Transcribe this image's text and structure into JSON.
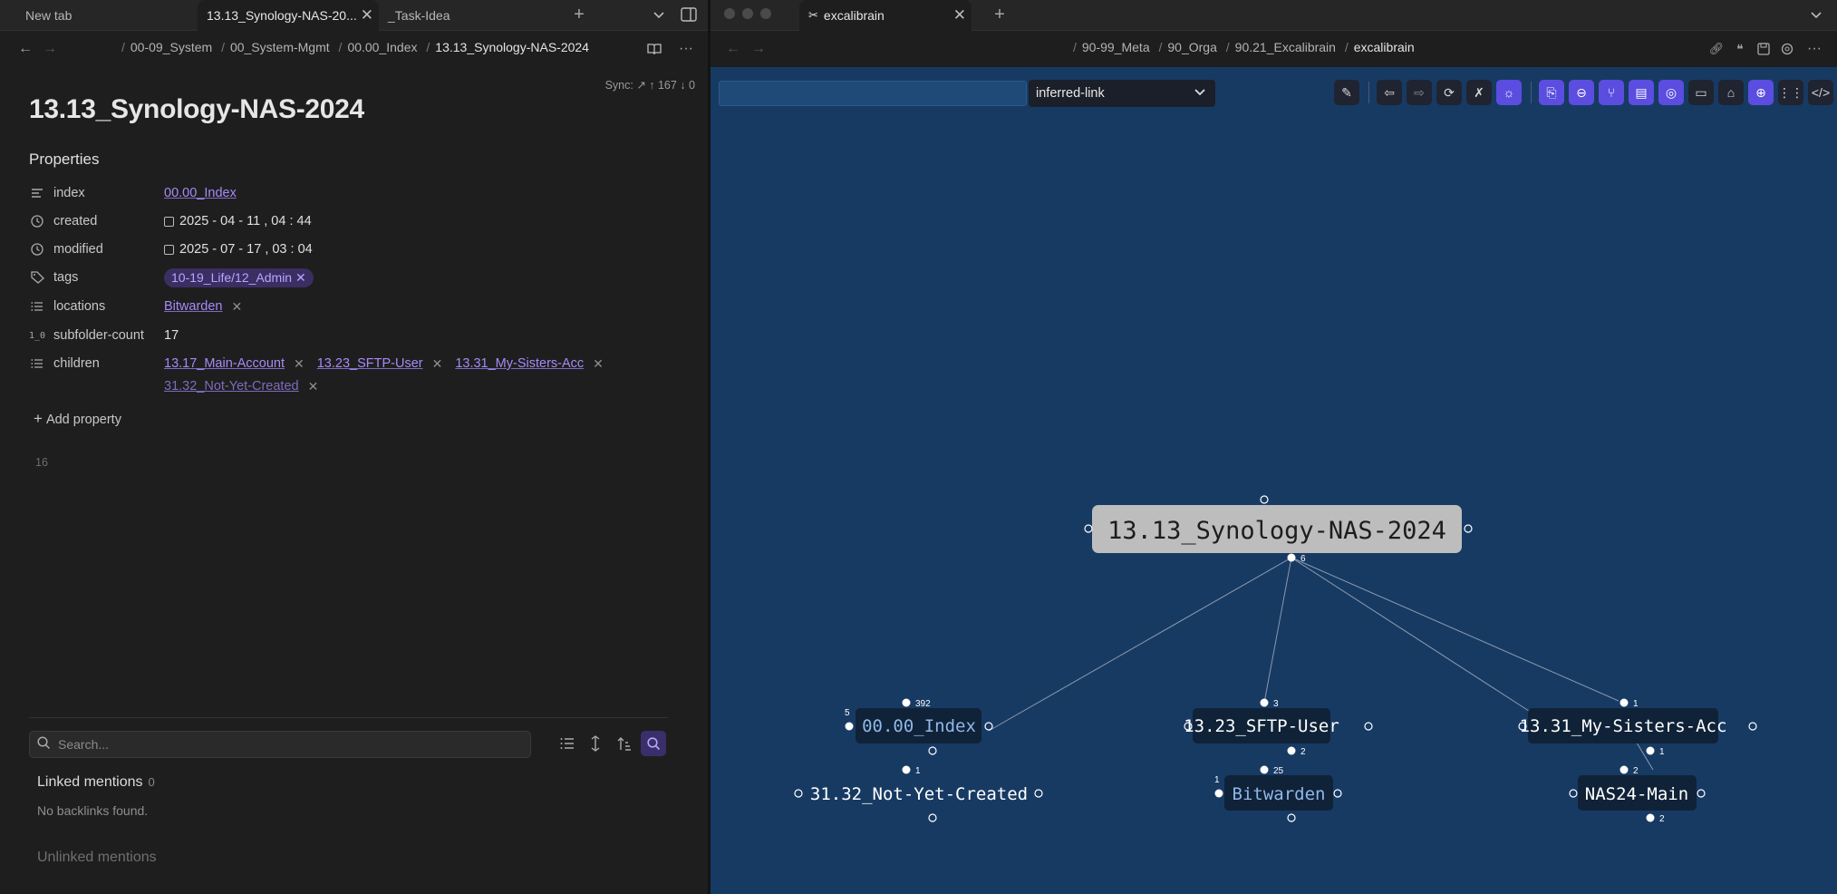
{
  "left": {
    "tabs": [
      {
        "label": "New tab"
      },
      {
        "label": "13.13_Synology-NAS-20..."
      },
      {
        "label": "_Task-Idea"
      }
    ],
    "breadcrumb": [
      {
        "label": "00-09_System"
      },
      {
        "label": "00_System-Mgmt"
      },
      {
        "label": "00.00_Index"
      },
      {
        "label": "13.13_Synology-NAS-2024"
      }
    ],
    "sync_text": "Sync: ↗ ↑ 167 ↓ 0",
    "title": "13.13_Synology-NAS-2024",
    "properties_heading": "Properties",
    "properties": {
      "index": {
        "key": "index",
        "value": "00.00_Index"
      },
      "created": {
        "key": "created",
        "date": "2025 - 04 - 11 ,  04 : 44"
      },
      "modified": {
        "key": "modified",
        "date": "2025 - 07 - 17 ,  03 : 04"
      },
      "tags": {
        "key": "tags",
        "value": "10-19_Life/12_Admin"
      },
      "locations": {
        "key": "locations",
        "value": "Bitwarden"
      },
      "subfolder": {
        "key": "subfolder-count",
        "value": "17"
      },
      "children": {
        "key": "children",
        "items": [
          {
            "label": "13.17_Main-Account"
          },
          {
            "label": "13.23_SFTP-User"
          },
          {
            "label": "13.31_My-Sisters-Acc"
          },
          {
            "label": "31.32_Not-Yet-Created"
          }
        ]
      }
    },
    "add_property": "Add property",
    "line_number": "16",
    "backlinks": {
      "search_placeholder": "Search...",
      "linked_title": "Linked mentions",
      "linked_count": "0",
      "no_backlinks": "No backlinks found.",
      "unlinked_title": "Unlinked mentions"
    }
  },
  "right": {
    "tab": {
      "label": "excalibrain"
    },
    "breadcrumb": [
      {
        "label": "90-99_Meta"
      },
      {
        "label": "90_Orga"
      },
      {
        "label": "90.21_Excalibrain"
      },
      {
        "label": "excalibrain"
      }
    ],
    "link_select": "inferred-link",
    "graph": {
      "central": {
        "label": "13.13_Synology-NAS-2024",
        "count": "6"
      },
      "nodes": {
        "index": {
          "label": "00.00_Index",
          "top_count": "392",
          "left_count": "5"
        },
        "sftp": {
          "label": "13.23_SFTP-User",
          "top_count": "3",
          "bottom_count": "2"
        },
        "sisters": {
          "label": "13.31_My-Sisters-Acc",
          "top_count": "1",
          "bottom_count": "1"
        },
        "notyet": {
          "label": "31.32_Not-Yet-Created",
          "top_count": "1"
        },
        "bitwarden": {
          "label": "Bitwarden",
          "top_count": "25",
          "left_count": "1"
        },
        "nas24": {
          "label": "NAS24-Main",
          "top_count": "2",
          "bottom_count": "2"
        }
      }
    }
  },
  "colors": {
    "accent": "#a68af9",
    "canvas_bg": "#173a63",
    "toolbar_active": "#5b4de0"
  }
}
